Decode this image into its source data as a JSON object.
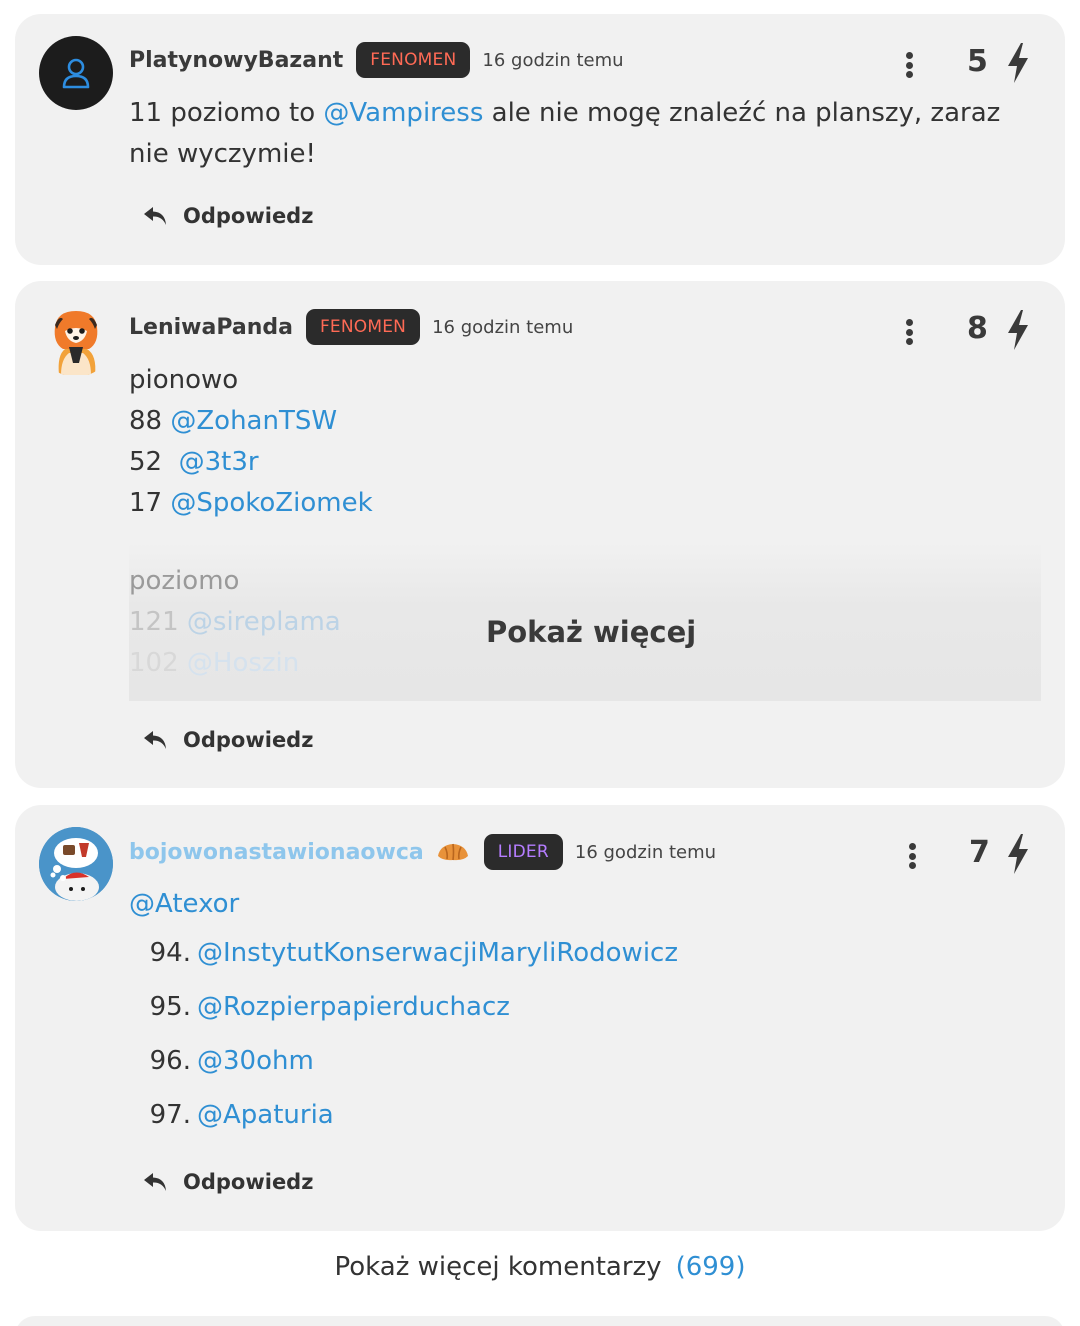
{
  "comments": [
    {
      "username": "PlatynowyBazant",
      "rank": "FENOMEN",
      "time": "16 godzin temu",
      "votes": "5",
      "avatar": "default-user-icon",
      "line1_text": "11 poziomo to ",
      "line1_mention": "@Vampiress",
      "line1_rest": " ale nie mogę znaleźć na planszy, zaraz",
      "line2_text": "nie wyczymie!",
      "reply_label": "Odpowiedz"
    },
    {
      "username": "LeniwaPanda",
      "rank": "FENOMEN",
      "time": "16 godzin temu",
      "votes": "8",
      "avatar": "red-panda-avatar",
      "heading": "pionowo",
      "lines": [
        {
          "number": "88",
          "mention": "@ZohanTSW"
        },
        {
          "number": "52",
          "mention": "@3t3r"
        },
        {
          "number": "17",
          "mention": "@SpokoZiomek"
        }
      ],
      "faded_heading": "poziomo",
      "faded_lines": [
        {
          "number": "121",
          "mention": "@sireplama"
        },
        {
          "number": "102",
          "mention": "@Hoszin"
        }
      ],
      "show_more_label": "Pokaż więcej",
      "reply_label": "Odpowiedz"
    },
    {
      "username": "bojowonastawionaowca",
      "user_emoji": "croissant-icon",
      "rank": "LIDER",
      "time": "16 godzin temu",
      "votes": "7",
      "avatar": "sheep-dreaming-avatar",
      "mention_top": "@Atexor",
      "list": [
        {
          "number": "94.",
          "mention": "@InstytutKonserwacjiMaryliRodowicz"
        },
        {
          "number": "95.",
          "mention": "@Rozpierpapierduchacz"
        },
        {
          "number": "96.",
          "mention": "@30ohm"
        },
        {
          "number": "97.",
          "mention": "@Apaturia"
        }
      ],
      "reply_label": "Odpowiedz"
    }
  ],
  "footer": {
    "more_comments_label": "Pokaż więcej komentarzy",
    "more_comments_count": "(699)"
  },
  "colors": {
    "card_bg": "#f1f1f1",
    "mention": "#2f8fd3",
    "fenomen": "#ff6a55",
    "lider": "#b57dff",
    "badge_bg": "#2b2b2b"
  }
}
